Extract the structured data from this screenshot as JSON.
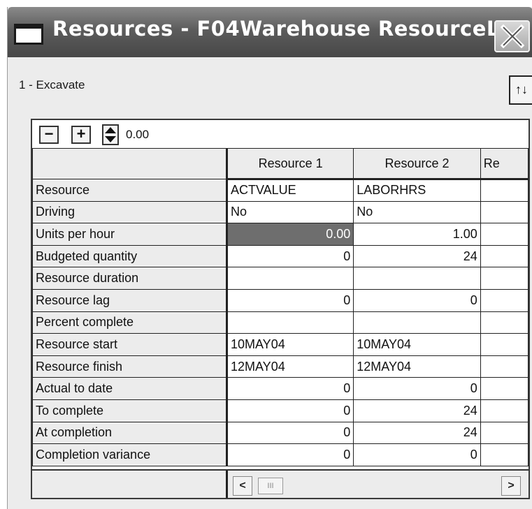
{
  "window": {
    "title": "Resources - F04Warehouse ResourceL ...",
    "close_glyph": "X"
  },
  "header": {
    "activity_label": "1 - Excavate",
    "sort_glyph": "↑↓"
  },
  "toolbar": {
    "minus_glyph": "−",
    "plus_glyph": "+",
    "value": "0.00"
  },
  "grid": {
    "columns": [
      "Resource 1",
      "Resource 2",
      "Re"
    ],
    "rows": [
      {
        "label": "Resource",
        "r1": "ACTVALUE",
        "r2": "LABORHRS"
      },
      {
        "label": "Driving",
        "r1": "No",
        "r2": "No"
      },
      {
        "label": "Units per hour",
        "r1": "0.00",
        "r2": "1.00"
      },
      {
        "label": "Budgeted quantity",
        "r1": "0",
        "r2": "24"
      },
      {
        "label": "Resource duration",
        "r1": "",
        "r2": ""
      },
      {
        "label": "Resource lag",
        "r1": "0",
        "r2": "0"
      },
      {
        "label": "Percent complete",
        "r1": "",
        "r2": ""
      },
      {
        "label": "Resource start",
        "r1": "10MAY04",
        "r2": "10MAY04"
      },
      {
        "label": "Resource finish",
        "r1": "12MAY04",
        "r2": "12MAY04"
      },
      {
        "label": "Actual to date",
        "r1": "0",
        "r2": "0"
      },
      {
        "label": "To complete",
        "r1": "0",
        "r2": "24"
      },
      {
        "label": "At completion",
        "r1": "0",
        "r2": "24"
      },
      {
        "label": "Completion variance",
        "r1": "0",
        "r2": "0"
      }
    ]
  },
  "scrollbar": {
    "left_glyph": "<",
    "right_glyph": ">",
    "thumb_glyph": "III"
  },
  "colors": {
    "titlebar": "#5c5c5c",
    "selected_cell": "#6e6e6e",
    "header_bg": "#ececec"
  },
  "icons": [
    "window-icon",
    "close-icon",
    "sort-icon",
    "spin-icon",
    "scroll-left-icon",
    "scroll-right-icon"
  ]
}
